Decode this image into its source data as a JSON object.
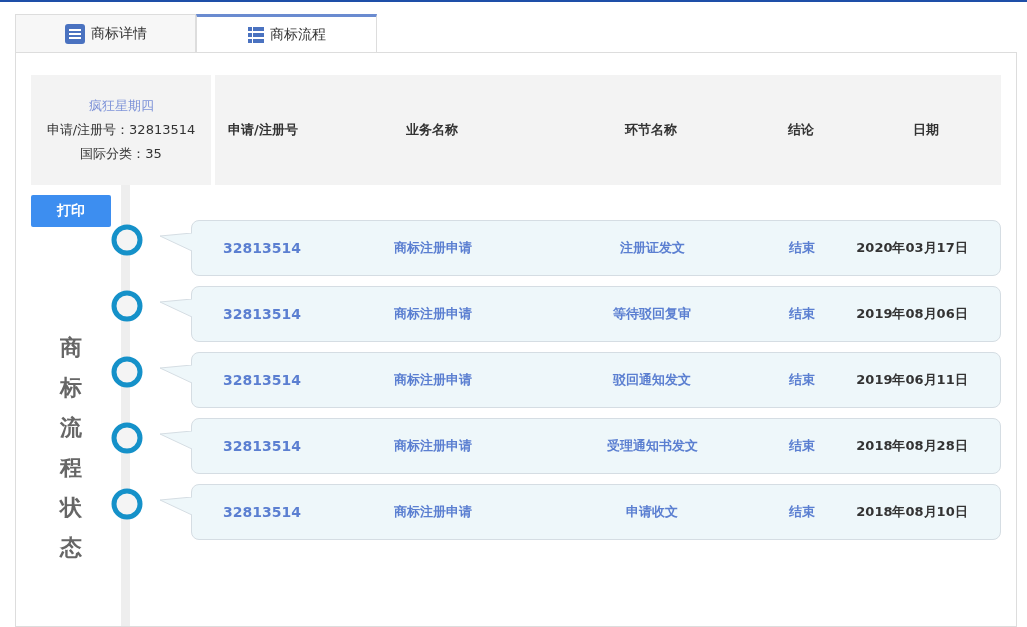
{
  "tabs": [
    {
      "label": "商标详情",
      "selected": false
    },
    {
      "label": "商标流程",
      "selected": true
    }
  ],
  "info": {
    "name": "疯狂星期四",
    "reg_no": "申请/注册号：32813514",
    "class": "国际分类：35"
  },
  "columns": [
    "申请/注册号",
    "业务名称",
    "环节名称",
    "结论",
    "日期"
  ],
  "print_button": "打印",
  "side_label": "商标流程状态",
  "rows": [
    {
      "reg_no": "32813514",
      "business": "商标注册申请",
      "step": "注册证发文",
      "result": "结束",
      "date": "2020年03月17日"
    },
    {
      "reg_no": "32813514",
      "business": "商标注册申请",
      "step": "等待驳回复审",
      "result": "结束",
      "date": "2019年08月06日"
    },
    {
      "reg_no": "32813514",
      "business": "商标注册申请",
      "step": "驳回通知发文",
      "result": "结束",
      "date": "2019年06月11日"
    },
    {
      "reg_no": "32813514",
      "business": "商标注册申请",
      "step": "受理通知书发文",
      "result": "结束",
      "date": "2018年08月28日"
    },
    {
      "reg_no": "32813514",
      "business": "商标注册申请",
      "step": "申请收文",
      "result": "结束",
      "date": "2018年08月10日"
    }
  ]
}
